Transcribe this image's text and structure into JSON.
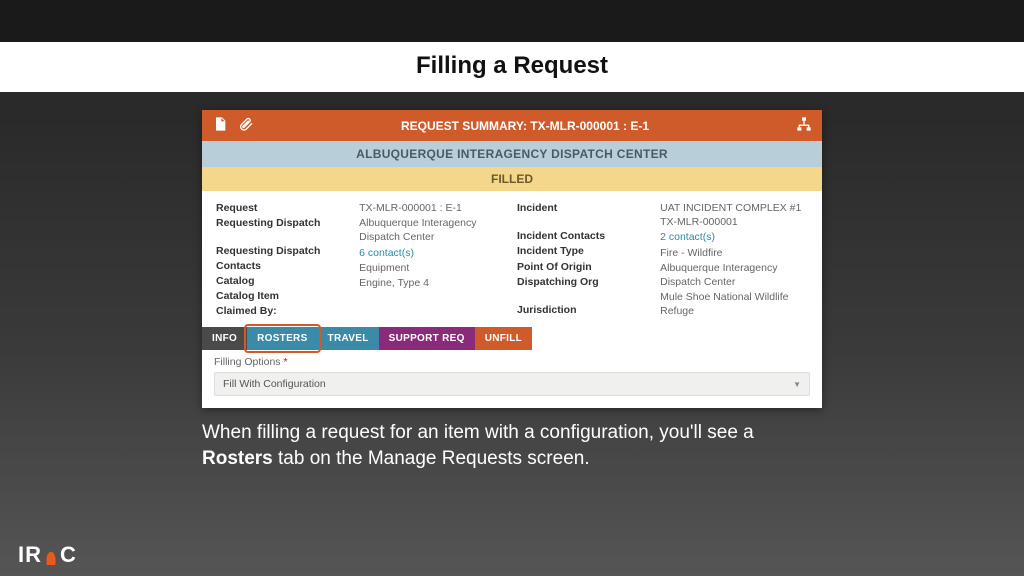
{
  "slide_title": "Filling a Request",
  "header": {
    "summary": "REQUEST SUMMARY: TX-MLR-000001 : E-1",
    "center": "ALBUQUERQUE INTERAGENCY DISPATCH CENTER",
    "status": "FILLED"
  },
  "left_labels": {
    "l1": "Request",
    "l2": "Requesting Dispatch",
    "l3": "Requesting Dispatch Contacts",
    "l4": "Catalog",
    "l5": "Catalog Item",
    "l6": "Claimed By:"
  },
  "left_vals": {
    "v1": "TX-MLR-000001 : E-1",
    "v2": "Albuquerque Interagency Dispatch Center",
    "v3": "6 contact(s)",
    "v4": "Equipment",
    "v5": "Engine, Type 4",
    "v6": ""
  },
  "right_labels": {
    "l1": "Incident",
    "l2": "Incident Contacts",
    "l3": "Incident Type",
    "l4": "Point Of Origin",
    "l5": "Dispatching Org",
    "l6": "Jurisdiction"
  },
  "right_vals": {
    "v1": "UAT INCIDENT COMPLEX #1 TX-MLR-000001",
    "v2": "2 contact(s)",
    "v3": "Fire - Wildfire",
    "v4": "",
    "v5": "Albuquerque Interagency Dispatch Center",
    "v6": "Mule Shoe National Wildlife Refuge"
  },
  "tabs": {
    "info": "INFO",
    "rosters": "ROSTERS",
    "travel": "TRAVEL",
    "support": "SUPPORT REQ",
    "unfill": "UNFILL"
  },
  "options": {
    "label": "Filling Options",
    "selected": "Fill With Configuration"
  },
  "caption": {
    "pre": "When filling a request for an item with a configuration, you'll see a ",
    "bold": "Rosters",
    "post": " tab on the Manage Requests screen."
  },
  "logo": {
    "a": "IR",
    "b": "C"
  }
}
